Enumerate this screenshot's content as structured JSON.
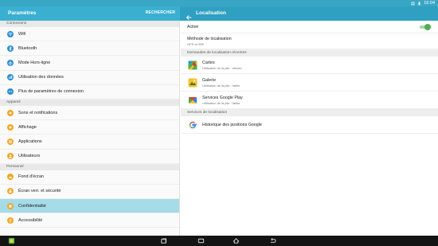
{
  "status_bar": {
    "time": "16:04"
  },
  "left_panel": {
    "title": "Paramètres",
    "search_label": "RECHERCHER",
    "sections": [
      {
        "header": "Connexions",
        "items": [
          {
            "label": "Wifi",
            "icon": "wifi-icon",
            "color": "#2b8fd4"
          },
          {
            "label": "Bluetooth",
            "icon": "bluetooth-icon",
            "color": "#2b8fd4"
          },
          {
            "label": "Mode Hors-ligne",
            "icon": "airplane-icon",
            "color": "#2b8fd4"
          },
          {
            "label": "Utilisation des données",
            "icon": "data-usage-icon",
            "color": "#2b8fd4"
          },
          {
            "label": "Plus de paramètres de connexion",
            "icon": "more-connections-icon",
            "color": "#2b8fd4"
          }
        ]
      },
      {
        "header": "Appareil",
        "items": [
          {
            "label": "Sons et notifications",
            "icon": "sound-icon",
            "color": "#f5a623"
          },
          {
            "label": "Affichage",
            "icon": "display-icon",
            "color": "#f5a623"
          },
          {
            "label": "Applications",
            "icon": "applications-icon",
            "color": "#f5a623"
          },
          {
            "label": "Utilisateurs",
            "icon": "users-icon",
            "color": "#f5a623"
          }
        ]
      },
      {
        "header": "Personnel",
        "items": [
          {
            "label": "Fond d'écran",
            "icon": "wallpaper-icon",
            "color": "#f5a623"
          },
          {
            "label": "Écran verr. et sécurité",
            "icon": "lock-screen-icon",
            "color": "#f5a623"
          },
          {
            "label": "Confidentialité",
            "icon": "privacy-icon",
            "color": "#f5a623",
            "selected": true
          },
          {
            "label": "Accessibilité",
            "icon": "accessibility-icon",
            "color": "#f5a623"
          }
        ]
      }
    ]
  },
  "right_panel": {
    "title": "Localisation",
    "active_label": "Activé",
    "active_on": true,
    "method": {
      "title": "Méthode de localisation",
      "subtitle": "GPS et Wifi"
    },
    "recent_header": "Demandes de localisation récentes",
    "recent_apps": [
      {
        "name": "Cartes",
        "detail": "Utilisation de la pile : élevée",
        "icon": "maps-icon"
      },
      {
        "name": "Galerie",
        "detail": "Utilisation de la pile : faible",
        "icon": "gallery-icon"
      },
      {
        "name": "Services Google Play",
        "detail": "Utilisation de la pile : faible",
        "icon": "google-play-services-icon"
      }
    ],
    "services_header": "Services de localisation",
    "services": [
      {
        "name": "Historique des positions Google",
        "icon": "google-icon"
      }
    ]
  },
  "colors": {
    "status_bar": "#3aa6c6",
    "left_appbar": "#3ab0d1",
    "right_appbar": "#2fa0c2",
    "selected_row": "#a6dbe8",
    "toggle_on": "#4caf50"
  }
}
